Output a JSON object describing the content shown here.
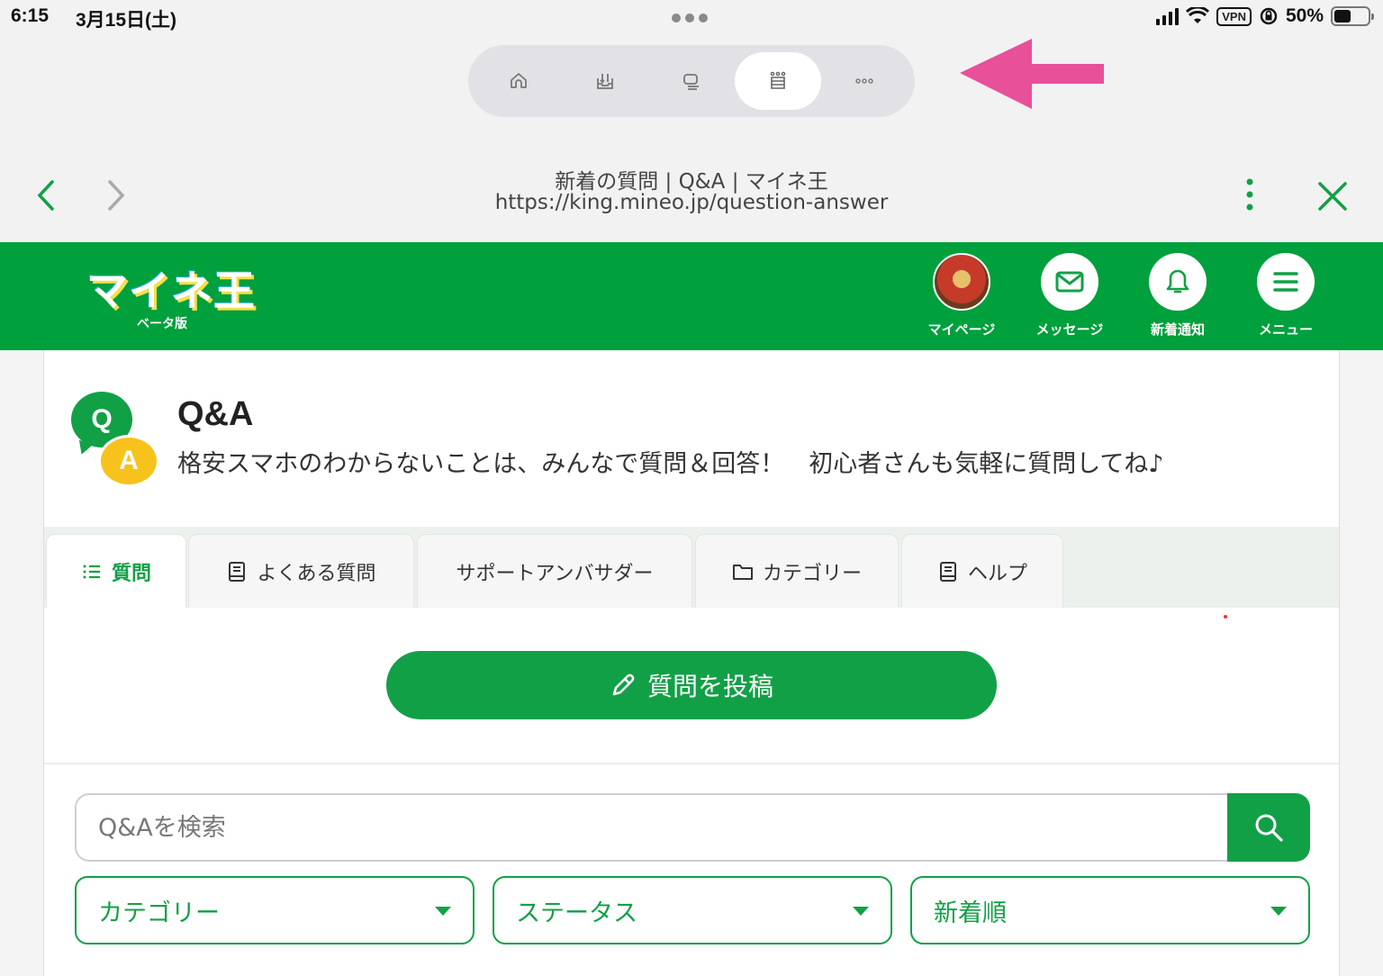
{
  "status_bar": {
    "time": "6:15",
    "date": "3月15日(土)",
    "vpn": "VPN",
    "battery_percent": "50%",
    "battery_level": 0.5
  },
  "toolbar": {
    "buttons": [
      "home-icon",
      "download-tray-icon",
      "reader-icon",
      "crown-icon",
      "more-icon"
    ],
    "active_index": 3
  },
  "browser": {
    "page_title": "新着の質問 | Q&A | マイネ王",
    "url": "https://king.mineo.jp/question-answer"
  },
  "site_header": {
    "logo_text": "マイネ王",
    "logo_sub": "ベータ版",
    "nav": [
      {
        "label": "マイページ",
        "icon": "avatar"
      },
      {
        "label": "メッセージ",
        "icon": "mail-icon"
      },
      {
        "label": "新着通知",
        "icon": "bell-icon"
      },
      {
        "label": "メニュー",
        "icon": "hamburger-icon"
      }
    ]
  },
  "qa": {
    "title": "Q&A",
    "subtitle": "格安スマホのわからないことは、みんなで質問＆回答！　初心者さんも気軽に質問してね♪",
    "icon_q": "Q",
    "icon_a": "A"
  },
  "tabs": [
    {
      "label": "質問",
      "icon": "list-icon",
      "active": true
    },
    {
      "label": "よくある質問",
      "icon": "book-icon",
      "active": false
    },
    {
      "label": "サポートアンバサダー",
      "icon": "",
      "active": false
    },
    {
      "label": "カテゴリー",
      "icon": "folder-icon",
      "active": false
    },
    {
      "label": "ヘルプ",
      "icon": "book-icon",
      "active": false
    }
  ],
  "post_button": {
    "label": "質問を投稿",
    "icon": "pencil-icon"
  },
  "search": {
    "placeholder": "Q&Aを検索",
    "value": ""
  },
  "filters": [
    {
      "label": "カテゴリー"
    },
    {
      "label": "ステータス"
    },
    {
      "label": "新着順"
    }
  ],
  "colors": {
    "brand_green": "#00a03c",
    "accent_green": "#12a046",
    "annotation_arrow": "#e8509a"
  }
}
